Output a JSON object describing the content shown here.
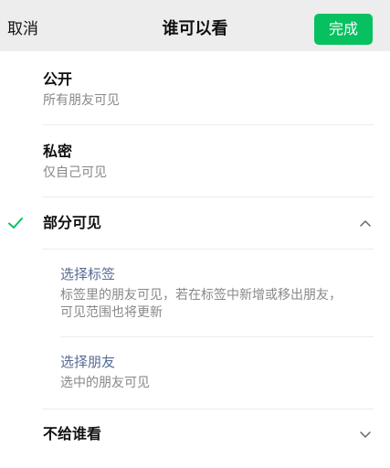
{
  "header": {
    "cancel_label": "取消",
    "title": "谁可以看",
    "done_label": "完成"
  },
  "options": {
    "public": {
      "title": "公开",
      "desc": "所有朋友可见"
    },
    "private": {
      "title": "私密",
      "desc": "仅自己可见"
    },
    "partial": {
      "title": "部分可见",
      "selected": true,
      "expanded": true,
      "sub": {
        "tags": {
          "title": "选择标签",
          "desc": "标签里的朋友可见，若在标签中新增或移出朋友，可见范围也将更新"
        },
        "friends": {
          "title": "选择朋友",
          "desc": "选中的朋友可见"
        }
      }
    },
    "exclude": {
      "title": "不给谁看",
      "expanded": false
    }
  },
  "colors": {
    "accent": "#07c160",
    "link": "#576b95",
    "secondary_text": "#888888"
  },
  "icons": {
    "selected": "check-icon",
    "expanded": "chevron-up-icon",
    "collapsed": "chevron-down-icon"
  }
}
